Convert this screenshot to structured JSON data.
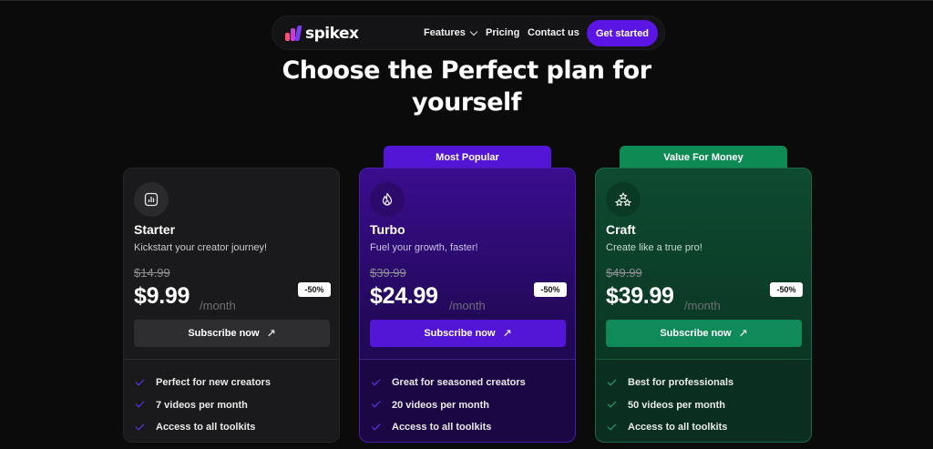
{
  "nav": {
    "brand": "spikex",
    "links": {
      "features": "Features",
      "pricing": "Pricing",
      "contact": "Contact us"
    },
    "cta": "Get started"
  },
  "heading": {
    "line1": "Choose the Perfect plan for",
    "line2": "yourself"
  },
  "tabs": {
    "turbo": "Most Popular",
    "craft": "Value For Money"
  },
  "plans": [
    {
      "name": "Starter",
      "tagline": "Kickstart your creator journey!",
      "old_price": "$14.99",
      "price": "$9.99",
      "per": "/month",
      "discount": "-50%",
      "cta": "Subscribe now",
      "features": [
        "Perfect for new creators",
        "7 videos per month",
        "Access to all toolkits"
      ],
      "icon": "bar-chart-icon",
      "accent": "#2e2e31"
    },
    {
      "name": "Turbo",
      "tagline": "Fuel your growth, faster!",
      "old_price": "$39.99",
      "price": "$24.99",
      "per": "/month",
      "discount": "-50%",
      "cta": "Subscribe now",
      "features": [
        "Great for seasoned creators",
        "20 videos per month",
        "Access to all toolkits"
      ],
      "icon": "flame-icon",
      "accent": "#5316d6"
    },
    {
      "name": "Craft",
      "tagline": "Create like a true pro!",
      "old_price": "$49.99",
      "price": "$39.99",
      "per": "/month",
      "discount": "-50%",
      "cta": "Subscribe now",
      "features": [
        "Best for professionals",
        "50 videos per month",
        "Access to all toolkits"
      ],
      "icon": "stars-icon",
      "accent": "#0f8a58"
    }
  ]
}
